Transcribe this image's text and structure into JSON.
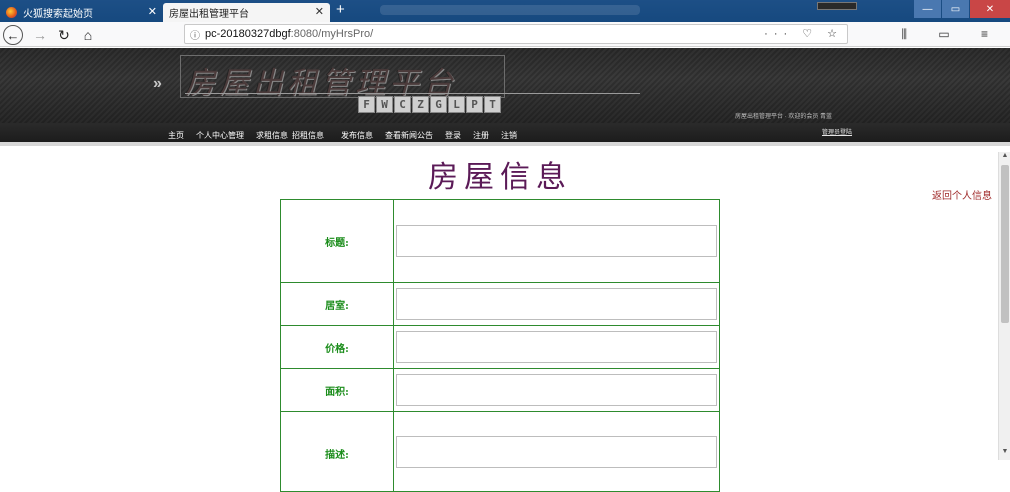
{
  "browser": {
    "tabs": [
      {
        "label": "火狐搜索起始页",
        "close": "✕"
      },
      {
        "label": "房屋出租管理平台",
        "close": "✕"
      }
    ],
    "new_tab": "+",
    "url_host": "pc-20180327dbgf",
    "url_rest": ":8080/myHrsPro/",
    "url_info": "ⓘ",
    "url_actions": "··· ♡ ☆",
    "right_tools": "⫼ ▭ ≡",
    "window_controls": [
      "—",
      "▭",
      "✕"
    ]
  },
  "site": {
    "logo_title": "房屋出租管理平台",
    "logo_sub": [
      "F",
      "W",
      "C",
      "Z",
      "G",
      "L",
      "P",
      "T"
    ],
    "welcome": "房屋出租管理平台 · 欢迎的会员 青蓝",
    "menu": [
      "主页",
      "个人中心管理",
      "求租信息",
      "招租信息",
      "发布信息",
      "查看新闻公告",
      "登录",
      "注册",
      "注销"
    ],
    "admin_link": "管理员登陆"
  },
  "content": {
    "page_title": "房屋信息",
    "return_link": "返回个人信息",
    "fields": [
      {
        "label": "标题:",
        "value": ""
      },
      {
        "label": "居室:",
        "value": ""
      },
      {
        "label": "价格:",
        "value": ""
      },
      {
        "label": "面积:",
        "value": ""
      },
      {
        "label": "描述:",
        "value": ""
      }
    ]
  },
  "colors": {
    "title": "#5b1a57",
    "label": "#1b8d1b",
    "border": "#2e8b2e",
    "link": "#a02b2b"
  }
}
